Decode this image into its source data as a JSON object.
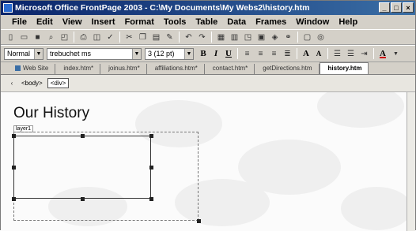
{
  "window": {
    "title": "Microsoft Office FrontPage 2003 - C:\\My Documents\\My Webs2\\history.htm"
  },
  "menu": [
    "File",
    "Edit",
    "View",
    "Insert",
    "Format",
    "Tools",
    "Table",
    "Data",
    "Frames",
    "Window",
    "Help"
  ],
  "format": {
    "style": "Normal",
    "font": "trebuchet ms",
    "size": "3 (12 pt)"
  },
  "tabs": [
    "Web Site",
    "index.htm*",
    "joinus.htm*",
    "affiliations.htm*",
    "contact.htm*",
    "getDirections.htm",
    "history.htm"
  ],
  "tags": [
    "<body>",
    "<div>"
  ],
  "page": {
    "heading": "Our History",
    "layer_label": "layer1"
  }
}
